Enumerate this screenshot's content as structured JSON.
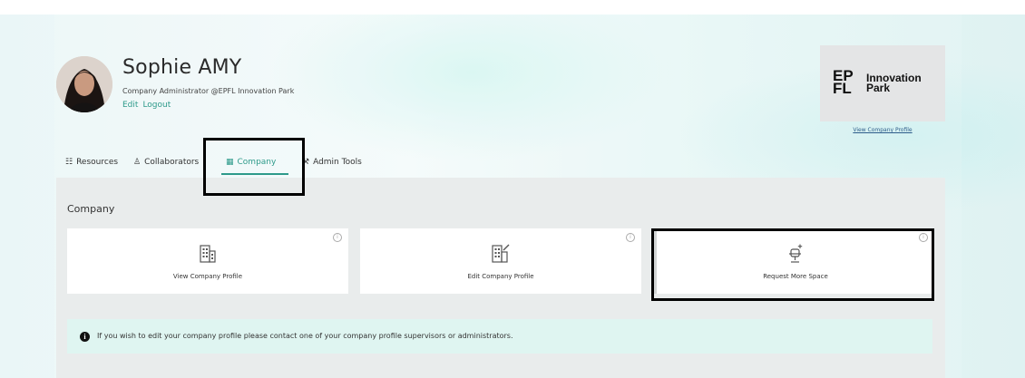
{
  "user": {
    "name": "Sophie AMY",
    "role": "Company Administrator @EPFL Innovation Park",
    "links": [
      "Edit",
      "Logout"
    ]
  },
  "logo": {
    "line1": "EP",
    "line2": "FL",
    "text1": "Innovation",
    "text2": "Park",
    "view_profile_link": "View Company Profile"
  },
  "tabs": [
    {
      "label": "Resources",
      "icon": "grid-icon",
      "active": false
    },
    {
      "label": "Collaborators",
      "icon": "user-icon",
      "active": false
    },
    {
      "label": "Company",
      "icon": "building-icon",
      "active": true
    },
    {
      "label": "Admin Tools",
      "icon": "tools-icon",
      "active": false
    }
  ],
  "section": {
    "title": "Company"
  },
  "cards": [
    {
      "label": "View Company Profile",
      "icon": "building-icon"
    },
    {
      "label": "Edit Company Profile",
      "icon": "building-edit-icon"
    },
    {
      "label": "Request More Space",
      "icon": "chair-add-icon"
    }
  ],
  "notice": {
    "text": "If you wish to edit your company profile please contact one of your company profile supervisors or administrators."
  },
  "colors": {
    "accent": "#2d9a8a",
    "panel": "#e9ecec",
    "notice_bg": "#dff5f1"
  }
}
